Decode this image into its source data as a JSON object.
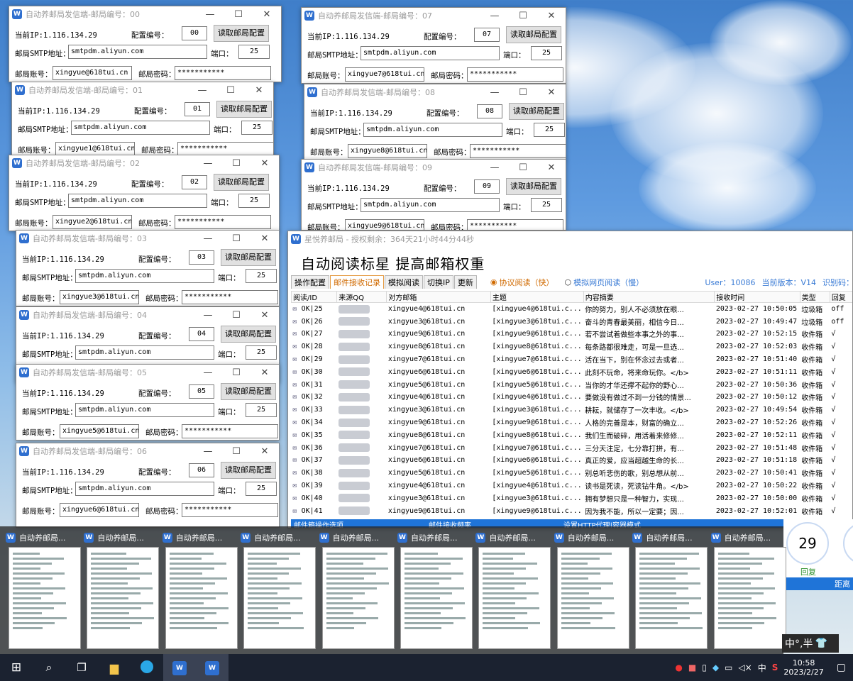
{
  "mail_windows": [
    {
      "title": "自动养邮局发信端-邮局编号：00",
      "ip_label": "当前IP:",
      "ip": "1.116.134.29",
      "cfg_label": "配置编号：",
      "cfg": "00",
      "read_btn": "读取邮局配置",
      "smtp_label": "邮局SMTP地址：",
      "smtp": "smtpdm.aliyun.com",
      "port_label": "端口：",
      "port": "25",
      "acct_label": "邮局账号：",
      "acct": "xingyue@618tui.cn",
      "pwd_label": "邮局密码：",
      "pwd": "***********"
    },
    {
      "title": "自动养邮局发信端-邮局编号：01",
      "ip_label": "当前IP:",
      "ip": "1.116.134.29",
      "cfg_label": "配置编号：",
      "cfg": "01",
      "read_btn": "读取邮局配置",
      "smtp_label": "邮局SMTP地址：",
      "smtp": "smtpdm.aliyun.com",
      "port_label": "端口：",
      "port": "25",
      "acct_label": "邮局账号：",
      "acct": "xingyue1@618tui.cn",
      "pwd_label": "邮局密码：",
      "pwd": "***********"
    },
    {
      "title": "自动养邮局发信端-邮局编号：02",
      "ip_label": "当前IP:",
      "ip": "1.116.134.29",
      "cfg_label": "配置编号：",
      "cfg": "02",
      "read_btn": "读取邮局配置",
      "smtp_label": "邮局SMTP地址：",
      "smtp": "smtpdm.aliyun.com",
      "port_label": "端口：",
      "port": "25",
      "acct_label": "邮局账号：",
      "acct": "xingyue2@618tui.cn",
      "pwd_label": "邮局密码：",
      "pwd": "***********"
    },
    {
      "title": "自动养邮局发信端-邮局编号：03",
      "ip_label": "当前IP:",
      "ip": "1.116.134.29",
      "cfg_label": "配置编号：",
      "cfg": "03",
      "read_btn": "读取邮局配置",
      "smtp_label": "邮局SMTP地址：",
      "smtp": "smtpdm.aliyun.com",
      "port_label": "端口：",
      "port": "25",
      "acct_label": "邮局账号：",
      "acct": "xingyue3@618tui.cn",
      "pwd_label": "邮局密码：",
      "pwd": "***********"
    },
    {
      "title": "自动养邮局发信端-邮局编号：04",
      "ip_label": "当前IP:",
      "ip": "1.116.134.29",
      "cfg_label": "配置编号：",
      "cfg": "04",
      "read_btn": "读取邮局配置",
      "smtp_label": "邮局SMTP地址：",
      "smtp": "smtpdm.aliyun.com",
      "port_label": "端口：",
      "port": "25",
      "acct_label": "邮局账号：",
      "acct": "",
      "pwd_label": "邮局密码：",
      "pwd": ""
    },
    {
      "title": "自动养邮局发信端-邮局编号：05",
      "ip_label": "当前IP:",
      "ip": "1.116.134.29",
      "cfg_label": "配置编号：",
      "cfg": "05",
      "read_btn": "读取邮局配置",
      "smtp_label": "邮局SMTP地址：",
      "smtp": "smtpdm.aliyun.com",
      "port_label": "端口：",
      "port": "25",
      "acct_label": "邮局账号：",
      "acct": "xingyue5@618tui.cn",
      "pwd_label": "邮局密码：",
      "pwd": "***********"
    },
    {
      "title": "自动养邮局发信端-邮局编号：06",
      "ip_label": "当前IP:",
      "ip": "1.116.134.29",
      "cfg_label": "配置编号：",
      "cfg": "06",
      "read_btn": "读取邮局配置",
      "smtp_label": "邮局SMTP地址：",
      "smtp": "smtpdm.aliyun.com",
      "port_label": "端口：",
      "port": "25",
      "acct_label": "邮局账号：",
      "acct": "xingyue6@618tui.cn",
      "pwd_label": "邮局密码：",
      "pwd": "***********"
    },
    {
      "title": "自动养邮局发信端-邮局编号：07",
      "ip_label": "当前IP:",
      "ip": "1.116.134.29",
      "cfg_label": "配置编号：",
      "cfg": "07",
      "read_btn": "读取邮局配置",
      "smtp_label": "邮局SMTP地址：",
      "smtp": "smtpdm.aliyun.com",
      "port_label": "端口：",
      "port": "25",
      "acct_label": "邮局账号：",
      "acct": "xingyue7@618tui.cn",
      "pwd_label": "邮局密码：",
      "pwd": "***********"
    },
    {
      "title": "自动养邮局发信端-邮局编号：08",
      "ip_label": "当前IP:",
      "ip": "1.116.134.29",
      "cfg_label": "配置编号：",
      "cfg": "08",
      "read_btn": "读取邮局配置",
      "smtp_label": "邮局SMTP地址：",
      "smtp": "smtpdm.aliyun.com",
      "port_label": "端口：",
      "port": "25",
      "acct_label": "邮局账号：",
      "acct": "xingyue8@618tui.cn",
      "pwd_label": "邮局密码：",
      "pwd": "***********"
    },
    {
      "title": "自动养邮局发信端-邮局编号：09",
      "ip_label": "当前IP:",
      "ip": "1.116.134.29",
      "cfg_label": "配置编号：",
      "cfg": "09",
      "read_btn": "读取邮局配置",
      "smtp_label": "邮局SMTP地址：",
      "smtp": "smtpdm.aliyun.com",
      "port_label": "端口：",
      "port": "25",
      "acct_label": "邮局账号：",
      "acct": "xingyue9@618tui.cn",
      "pwd_label": "邮局密码：",
      "pwd": "***********"
    }
  ],
  "main": {
    "title": "星悦养邮局 - 授权剩余：364天21小时44分44秒",
    "banner": "自动阅读标星 提高邮箱权重",
    "tabs": [
      "操作配置",
      "邮件接收记录",
      "模拟阅读",
      "切换IP",
      "更新"
    ],
    "radio1": "协议阅读（快）",
    "radio2": "模拟网页阅读（慢）",
    "user": "User：10086",
    "version": "当前版本：V14",
    "code": "识别码：",
    "columns": [
      "阅读/ID",
      "来源QQ",
      "对方邮箱",
      "主题",
      "内容摘要",
      "接收时间",
      "类型",
      "回复"
    ],
    "rows": [
      [
        "OK|25",
        "xingyue4@618tui.cn",
        "[xingyue4@618tui.c...",
        "你的努力，别人不必须放在眼...",
        "2023-02-27 10:50:05",
        "垃圾箱",
        "off"
      ],
      [
        "OK|26",
        "xingyue3@618tui.cn",
        "[xingyue3@618tui.c...",
        "奋斗的青春最美丽，相信今日...",
        "2023-02-27 10:49:47",
        "垃圾箱",
        "off"
      ],
      [
        "OK|27",
        "xingyue9@618tui.cn",
        "[xingyue9@618tui.c...",
        "若不尝试着做些本事之外的事...",
        "2023-02-27 10:52:15",
        "收件箱",
        "√"
      ],
      [
        "OK|28",
        "xingyue8@618tui.cn",
        "[xingyue8@618tui.c...",
        "每条路都很难走，可是一旦选...",
        "2023-02-27 10:52:03",
        "收件箱",
        "√"
      ],
      [
        "OK|29",
        "xingyue7@618tui.cn",
        "[xingyue7@618tui.c...",
        "活在当下，别在怀念过去或者...",
        "2023-02-27 10:51:40",
        "收件箱",
        "√"
      ],
      [
        "OK|30",
        "xingyue6@618tui.cn",
        "[xingyue6@618tui.c...",
        "此刻不玩命，将来命玩你。</b>",
        "2023-02-27 10:51:11",
        "收件箱",
        "√"
      ],
      [
        "OK|31",
        "xingyue5@618tui.cn",
        "[xingyue5@618tui.c...",
        "当你的才华还撑不起你的野心...",
        "2023-02-27 10:50:36",
        "收件箱",
        "√"
      ],
      [
        "OK|32",
        "xingyue4@618tui.cn",
        "[xingyue4@618tui.c...",
        "要做没有做过不到一分钱的情景...",
        "2023-02-27 10:50:12",
        "收件箱",
        "√"
      ],
      [
        "OK|33",
        "xingyue3@618tui.cn",
        "[xingyue3@618tui.c...",
        "耕耘，就储存了一次丰收。</b>",
        "2023-02-27 10:49:54",
        "收件箱",
        "√"
      ],
      [
        "OK|34",
        "xingyue9@618tui.cn",
        "[xingyue9@618tui.c...",
        "人格的完善是本，财富的确立...",
        "2023-02-27 10:52:26",
        "收件箱",
        "√"
      ],
      [
        "OK|35",
        "xingyue8@618tui.cn",
        "[xingyue8@618tui.c...",
        "我们生而破碎，用活着来修修...",
        "2023-02-27 10:52:11",
        "收件箱",
        "√"
      ],
      [
        "OK|36",
        "xingyue7@618tui.cn",
        "[xingyue7@618tui.c...",
        "三分天注定，七分靠打拼，有...",
        "2023-02-27 10:51:48",
        "收件箱",
        "√"
      ],
      [
        "OK|37",
        "xingyue6@618tui.cn",
        "[xingyue6@618tui.c...",
        "真正的爱，应当超越生命的长...",
        "2023-02-27 10:51:18",
        "收件箱",
        "√"
      ],
      [
        "OK|38",
        "xingyue5@618tui.cn",
        "[xingyue5@618tui.c...",
        "别总听悲伤的歌，别总想从前...",
        "2023-02-27 10:50:41",
        "收件箱",
        "√"
      ],
      [
        "OK|39",
        "xingyue4@618tui.cn",
        "[xingyue4@618tui.c...",
        "读书是死读，死读钻牛角。</b>",
        "2023-02-27 10:50:22",
        "收件箱",
        "√"
      ],
      [
        "OK|40",
        "xingyue3@618tui.cn",
        "[xingyue3@618tui.c...",
        "拥有梦想只是一种智力，实现...",
        "2023-02-27 10:50:00",
        "收件箱",
        "√"
      ],
      [
        "OK|41",
        "xingyue9@618tui.cn",
        "[xingyue9@618tui.c...",
        "因为我不能，所以一定要；因...",
        "2023-02-27 10:52:01",
        "收件箱",
        "√"
      ]
    ],
    "bottom_bar": [
      "邮件箱操作选项",
      "邮件接收频率",
      "设置HTTP代理|容器模式"
    ],
    "counter": "29",
    "counter_label": "回复",
    "side_label": "距离"
  },
  "thumbnail_title": "自动养邮局...",
  "ime": "中°,半",
  "taskbar": {
    "time": "10:58",
    "date": "2023/2/27",
    "ime": "中"
  },
  "colors": {
    "tab_active": "#d06a00",
    "taskbar": "#1b2230",
    "bottom_bar": "#1f74d8"
  }
}
